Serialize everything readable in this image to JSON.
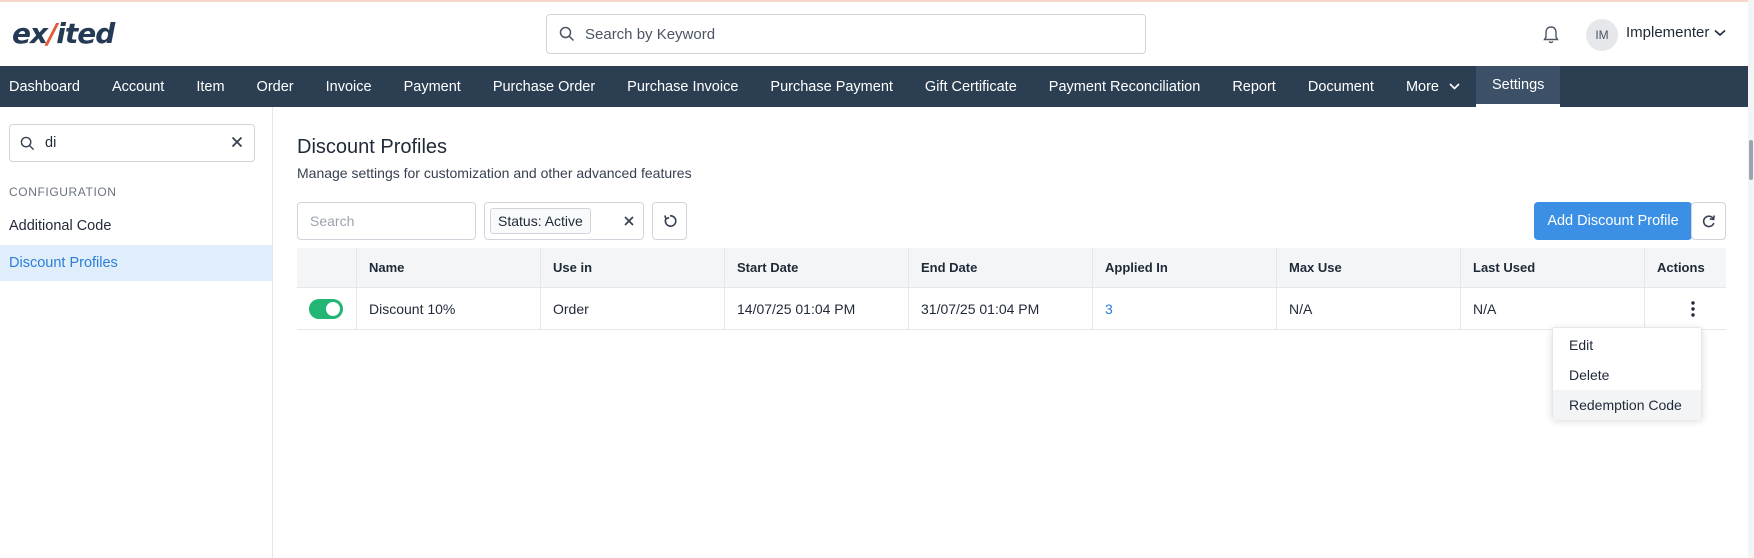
{
  "header": {
    "logo_prefix": "ex",
    "logo_accent": "",
    "logo_suffix": "ited",
    "search_placeholder": "Search by Keyword",
    "user_initials": "IM",
    "user_name": "Implementer"
  },
  "nav": {
    "items": [
      "Dashboard",
      "Account",
      "Item",
      "Order",
      "Invoice",
      "Payment",
      "Purchase Order",
      "Purchase Invoice",
      "Purchase Payment",
      "Gift Certificate",
      "Payment Reconciliation",
      "Report",
      "Document",
      "More",
      "Settings"
    ],
    "active": "Settings"
  },
  "sidebar": {
    "search_value": "di",
    "section_label": "CONFIGURATION",
    "items": [
      "Additional Code",
      "Discount Profiles"
    ],
    "active": "Discount Profiles"
  },
  "main": {
    "title": "Discount Profiles",
    "subtitle": "Manage settings for customization and other advanced features",
    "search_placeholder": "Search",
    "status_filter": "Status: Active",
    "add_button": "Add Discount Profile"
  },
  "table": {
    "columns": [
      "",
      "Name",
      "Use in",
      "Start Date",
      "End Date",
      "Applied In",
      "Max Use",
      "Last Used",
      "Actions"
    ],
    "rows": [
      {
        "enabled": true,
        "name": "Discount 10%",
        "use_in": "Order",
        "start_date": "14/07/25 01:04 PM",
        "end_date": "31/07/25 01:04 PM",
        "applied_in": "3",
        "max_use": "N/A",
        "last_used": "N/A"
      }
    ]
  },
  "row_menu": {
    "items": [
      "Edit",
      "Delete",
      "Redemption Code"
    ],
    "hovered": "Redemption Code"
  },
  "colors": {
    "nav_bg": "#2c3e52",
    "primary": "#3b8fe5",
    "toggle_on": "#22b573",
    "sidebar_active_bg": "#e0edfb",
    "link": "#2b7fd8"
  }
}
